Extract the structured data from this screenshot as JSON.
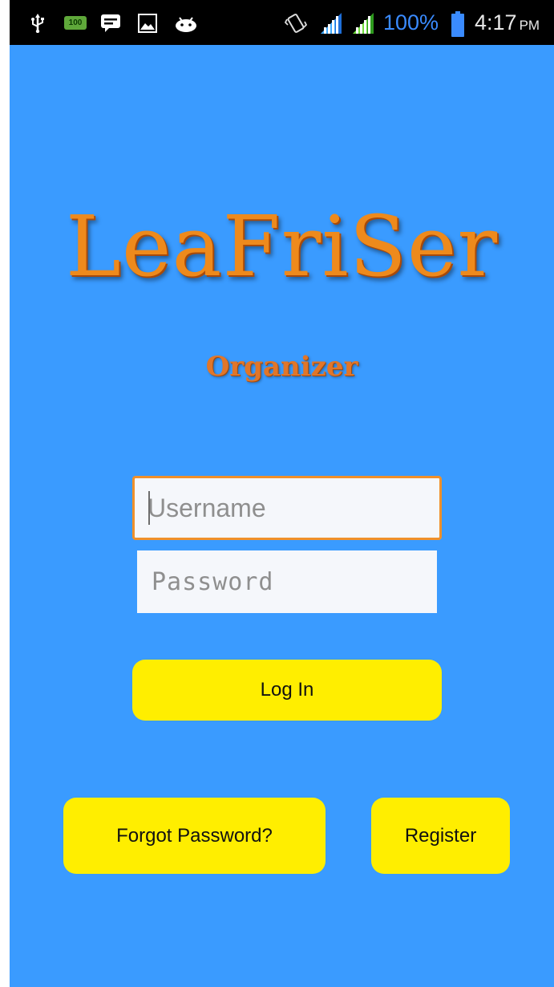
{
  "status_bar": {
    "battery_badge": "100",
    "battery_percent": "100%",
    "time": "4:17",
    "ampm": "PM",
    "icons": [
      "usb-icon",
      "battery-saver-icon",
      "message-icon",
      "image-icon",
      "android-icon",
      "vibrate-icon",
      "signal-icon",
      "signal-icon",
      "battery-icon"
    ]
  },
  "logo": {
    "title": "LeaFriSer",
    "subtitle": "Organizer"
  },
  "form": {
    "username_placeholder": "Username",
    "password_placeholder": "Password",
    "login_label": "Log In",
    "forgot_label": "Forgot Password?",
    "register_label": "Register"
  },
  "colors": {
    "background": "#3a9bff",
    "button": "#ffee00",
    "focus_border": "#f0902a",
    "logo": "#ee8a1c"
  }
}
